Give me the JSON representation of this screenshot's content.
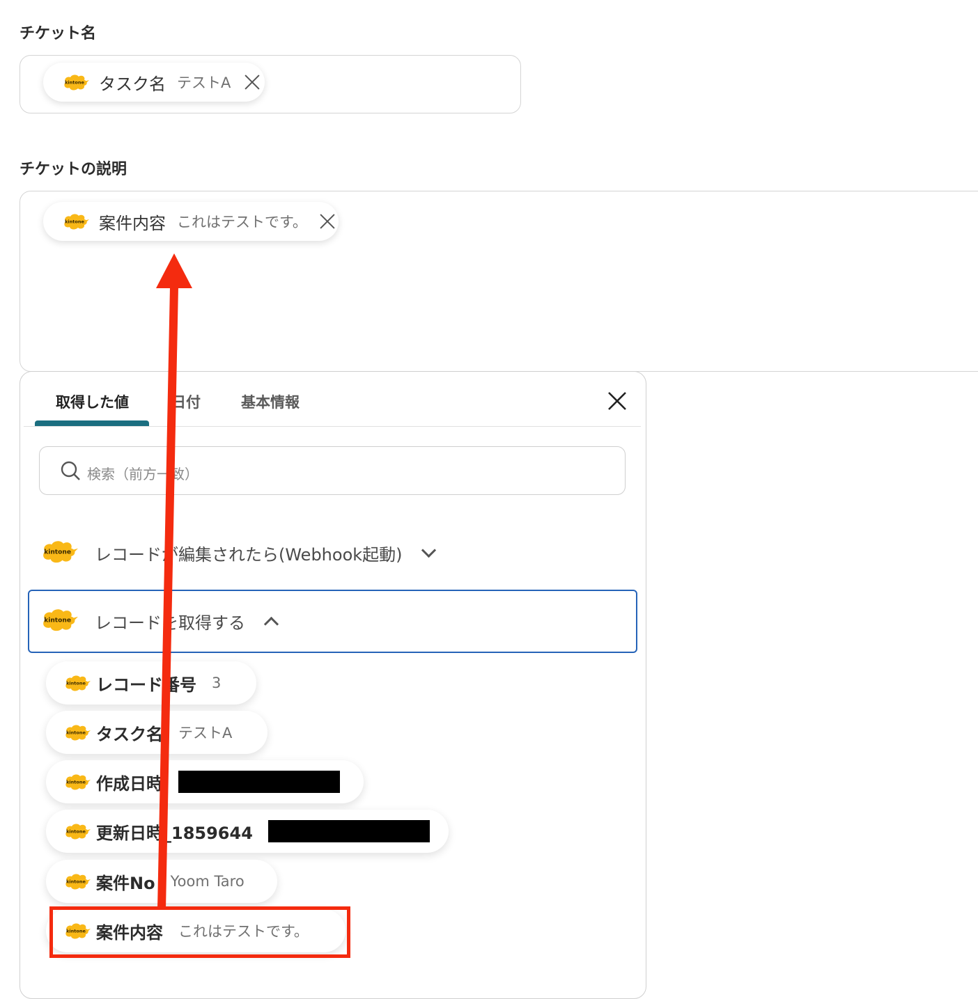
{
  "ticket_name": {
    "label": "チケット名",
    "chip": {
      "name": "タスク名",
      "value": "テストA"
    }
  },
  "ticket_description": {
    "label": "チケットの説明",
    "chip": {
      "name": "案件内容",
      "value": "これはテストです。"
    }
  },
  "panel": {
    "tabs": [
      {
        "label": "取得した値",
        "active": true
      },
      {
        "label": "日付",
        "active": false
      },
      {
        "label": "基本情報",
        "active": false
      }
    ],
    "search_placeholder": "検索（前方一致）",
    "sections": [
      {
        "title": "レコードが編集されたら(Webhook起動)",
        "expanded": false
      },
      {
        "title": "レコードを取得する",
        "expanded": true
      }
    ],
    "items": [
      {
        "name": "レコード番号",
        "value": "3"
      },
      {
        "name": "タスク名",
        "value": "テストA"
      },
      {
        "name": "作成日時",
        "value": null,
        "redacted": true
      },
      {
        "name": "更新日時_1859644",
        "value": null,
        "redacted": true
      },
      {
        "name": "案件No",
        "value": "Yoom Taro"
      },
      {
        "name": "案件内容",
        "value": "これはテストです。",
        "highlighted": true
      }
    ]
  },
  "app_logo_text": "kintone",
  "colors": {
    "accent_tab": "#1b6e80",
    "selected_border": "#2563b8",
    "annotation_red": "#f42b0f",
    "logo_yellow": "#f9b817"
  }
}
